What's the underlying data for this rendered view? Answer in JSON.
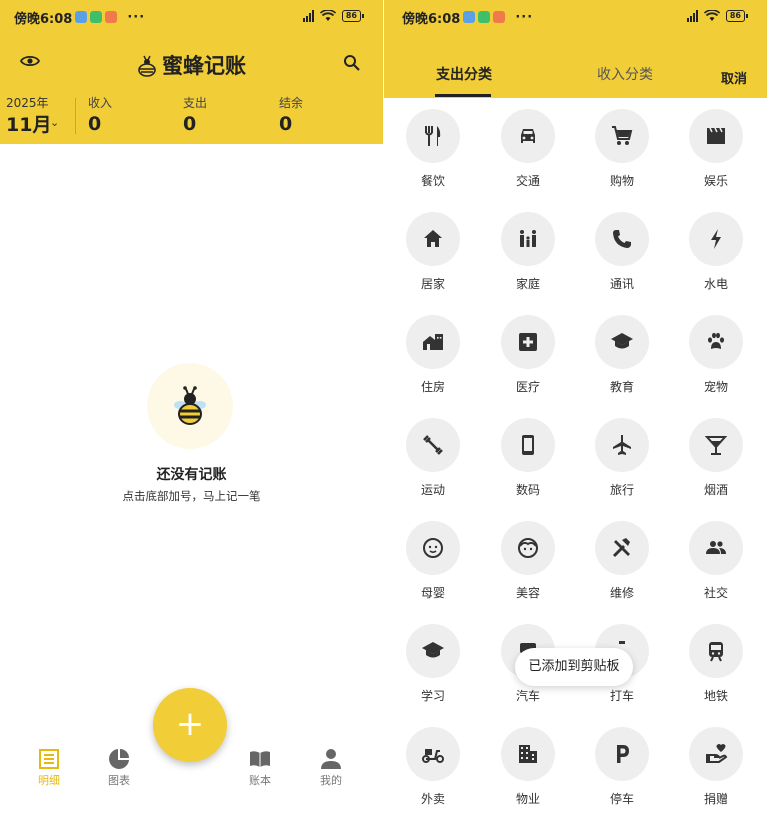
{
  "status": {
    "time": "傍晚6:08",
    "dots": "···",
    "battery": "86"
  },
  "colors": {
    "brand": "#f1cd38",
    "accent": "#e7b90f",
    "circle": "#eeeeee"
  },
  "home": {
    "app_title": "蜜蜂记账",
    "year": "2025年",
    "month": "11月",
    "income_label": "收入",
    "income_value": "0",
    "expense_label": "支出",
    "expense_value": "0",
    "balance_label": "结余",
    "balance_value": "0",
    "empty_title": "还没有记账",
    "empty_subtitle": "点击底部加号，马上记一笔",
    "fab_label": "+",
    "nav": [
      {
        "label": "明细",
        "icon": "list-icon",
        "active": true
      },
      {
        "label": "图表",
        "icon": "pie-chart-icon",
        "active": false
      },
      {
        "label": "账本",
        "icon": "book-icon",
        "active": false
      },
      {
        "label": "我的",
        "icon": "person-icon",
        "active": false
      }
    ]
  },
  "category": {
    "tab_expense": "支出分类",
    "tab_income": "收入分类",
    "cancel": "取消",
    "items": [
      {
        "label": "餐饮",
        "icon": "restaurant-icon"
      },
      {
        "label": "交通",
        "icon": "car-icon"
      },
      {
        "label": "购物",
        "icon": "cart-icon"
      },
      {
        "label": "娱乐",
        "icon": "clapperboard-icon"
      },
      {
        "label": "居家",
        "icon": "home-icon"
      },
      {
        "label": "家庭",
        "icon": "family-icon"
      },
      {
        "label": "通讯",
        "icon": "phone-icon"
      },
      {
        "label": "水电",
        "icon": "bolt-icon"
      },
      {
        "label": "住房",
        "icon": "house-icon"
      },
      {
        "label": "医疗",
        "icon": "medical-icon"
      },
      {
        "label": "教育",
        "icon": "school-icon"
      },
      {
        "label": "宠物",
        "icon": "paw-icon"
      },
      {
        "label": "运动",
        "icon": "dumbbell-icon"
      },
      {
        "label": "数码",
        "icon": "smartphone-icon"
      },
      {
        "label": "旅行",
        "icon": "airplane-icon"
      },
      {
        "label": "烟酒",
        "icon": "cocktail-icon"
      },
      {
        "label": "母婴",
        "icon": "baby-face-icon"
      },
      {
        "label": "美容",
        "icon": "face-icon"
      },
      {
        "label": "维修",
        "icon": "tools-icon"
      },
      {
        "label": "社交",
        "icon": "people-icon"
      },
      {
        "label": "学习",
        "icon": "graduation-cap-icon"
      },
      {
        "label": "汽车",
        "icon": "vehicle-icon"
      },
      {
        "label": "打车",
        "icon": "taxi-icon"
      },
      {
        "label": "地铁",
        "icon": "subway-icon"
      },
      {
        "label": "外卖",
        "icon": "scooter-icon"
      },
      {
        "label": "物业",
        "icon": "building-icon"
      },
      {
        "label": "停车",
        "icon": "parking-icon"
      },
      {
        "label": "捐赠",
        "icon": "donate-icon"
      }
    ],
    "toast": "已添加到剪贴板"
  }
}
